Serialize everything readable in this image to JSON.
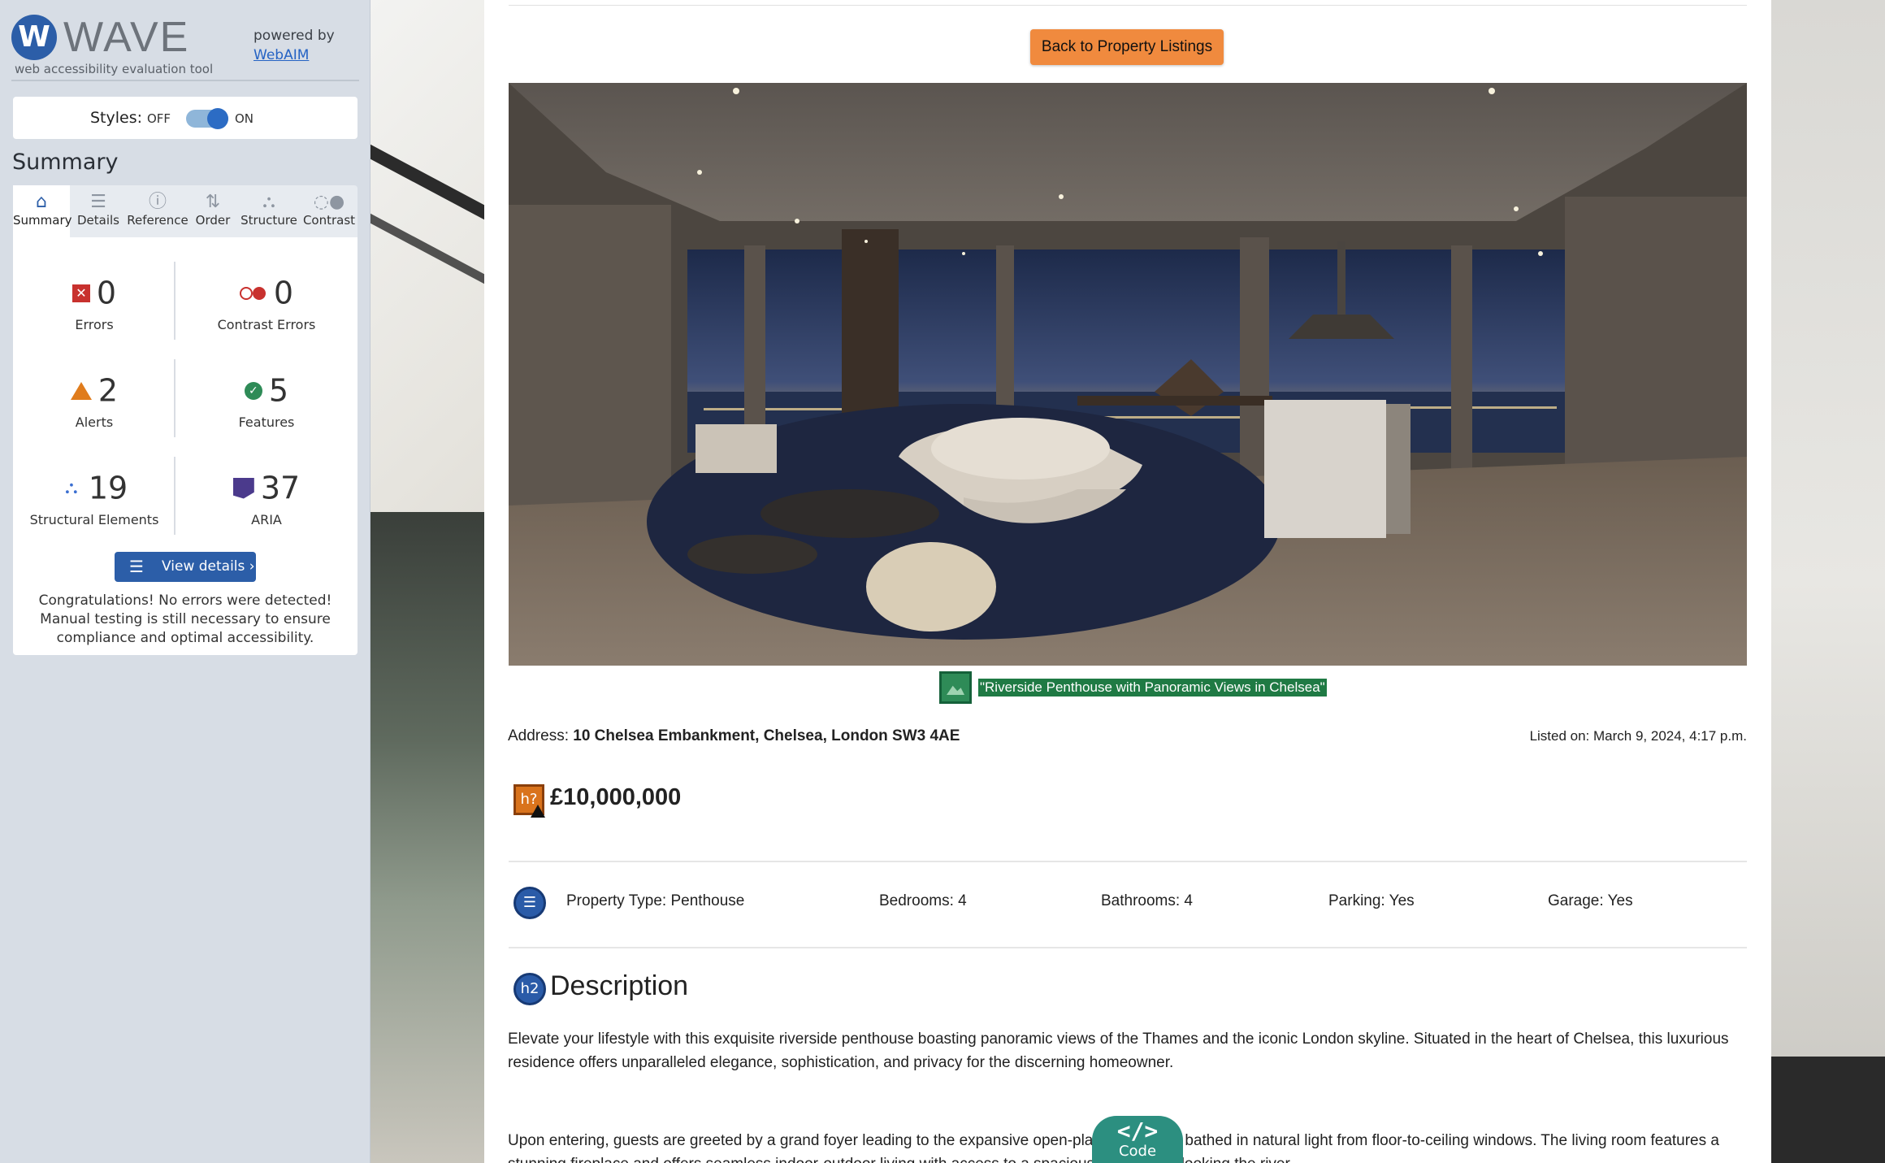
{
  "wave": {
    "logo_text": "WAVE",
    "tagline": "web accessibility evaluation tool",
    "powered_by": "powered by",
    "webaim_link": "WebAIM",
    "styles_label": "Styles:",
    "styles_off": "OFF",
    "styles_on": "ON",
    "styles_state": "on",
    "summary_title": "Summary",
    "tabs": [
      {
        "label": "Summary",
        "icon": "home-icon",
        "active": true
      },
      {
        "label": "Details",
        "icon": "list-icon",
        "active": false
      },
      {
        "label": "Reference",
        "icon": "info-icon",
        "active": false
      },
      {
        "label": "Order",
        "icon": "order-icon",
        "active": false
      },
      {
        "label": "Structure",
        "icon": "structure-icon",
        "active": false
      },
      {
        "label": "Contrast",
        "icon": "contrast-icon",
        "active": false
      }
    ],
    "stats": {
      "errors": {
        "count": "0",
        "label": "Errors",
        "color": "#c8312e"
      },
      "contrast_errors": {
        "count": "0",
        "label": "Contrast Errors",
        "color": "#c8312e"
      },
      "alerts": {
        "count": "2",
        "label": "Alerts",
        "color": "#e07c1c"
      },
      "features": {
        "count": "5",
        "label": "Features",
        "color": "#2e8b57"
      },
      "structural": {
        "count": "19",
        "label": "Structural Elements",
        "color": "#3b6fd1"
      },
      "aria": {
        "count": "37",
        "label": "ARIA",
        "color": "#4b3a8c"
      }
    },
    "view_details": "View details ›",
    "congrats": "Congratulations! No errors were detected! Manual testing is still necessary to ensure compliance and optimal accessibility."
  },
  "page": {
    "back_button": "Back to Property Listings",
    "image_caption": "\"Riverside Penthouse with Panoramic Views in Chelsea\"",
    "address_label": "Address:",
    "address_value": "10 Chelsea Embankment, Chelsea, London SW3 4AE",
    "listed_on": "Listed on: March 9, 2024, 4:17 p.m.",
    "price_icon": "h?",
    "price": "£10,000,000",
    "specs": {
      "property_type": "Property Type: Penthouse",
      "bedrooms": "Bedrooms: 4",
      "bathrooms": "Bathrooms: 4",
      "parking": "Parking: Yes",
      "garage": "Garage: Yes"
    },
    "description_icon": "h2",
    "description_heading": "Description",
    "description_p1": "Elevate your lifestyle with this exquisite riverside penthouse boasting panoramic views of the Thames and the iconic London skyline. Situated in the heart of Chelsea, this luxurious residence offers unparalleled elegance, sophistication, and privacy for the discerning homeowner.",
    "description_p2": "Upon entering, guests are greeted by a grand foyer leading to the expansive open-plan living area, bathed in natural light from floor-to-ceiling windows. The living room features a stunning fireplace and offers seamless indoor-outdoor living with access to a spacious terrace overlooking the river."
  },
  "code_tab": {
    "symbol": "</>",
    "label": "Code"
  },
  "colors": {
    "wave_blue": "#2c5ea8",
    "back_button": "#f08a3e",
    "feature_green": "#2e8b57",
    "alert_orange": "#e07c1c"
  }
}
